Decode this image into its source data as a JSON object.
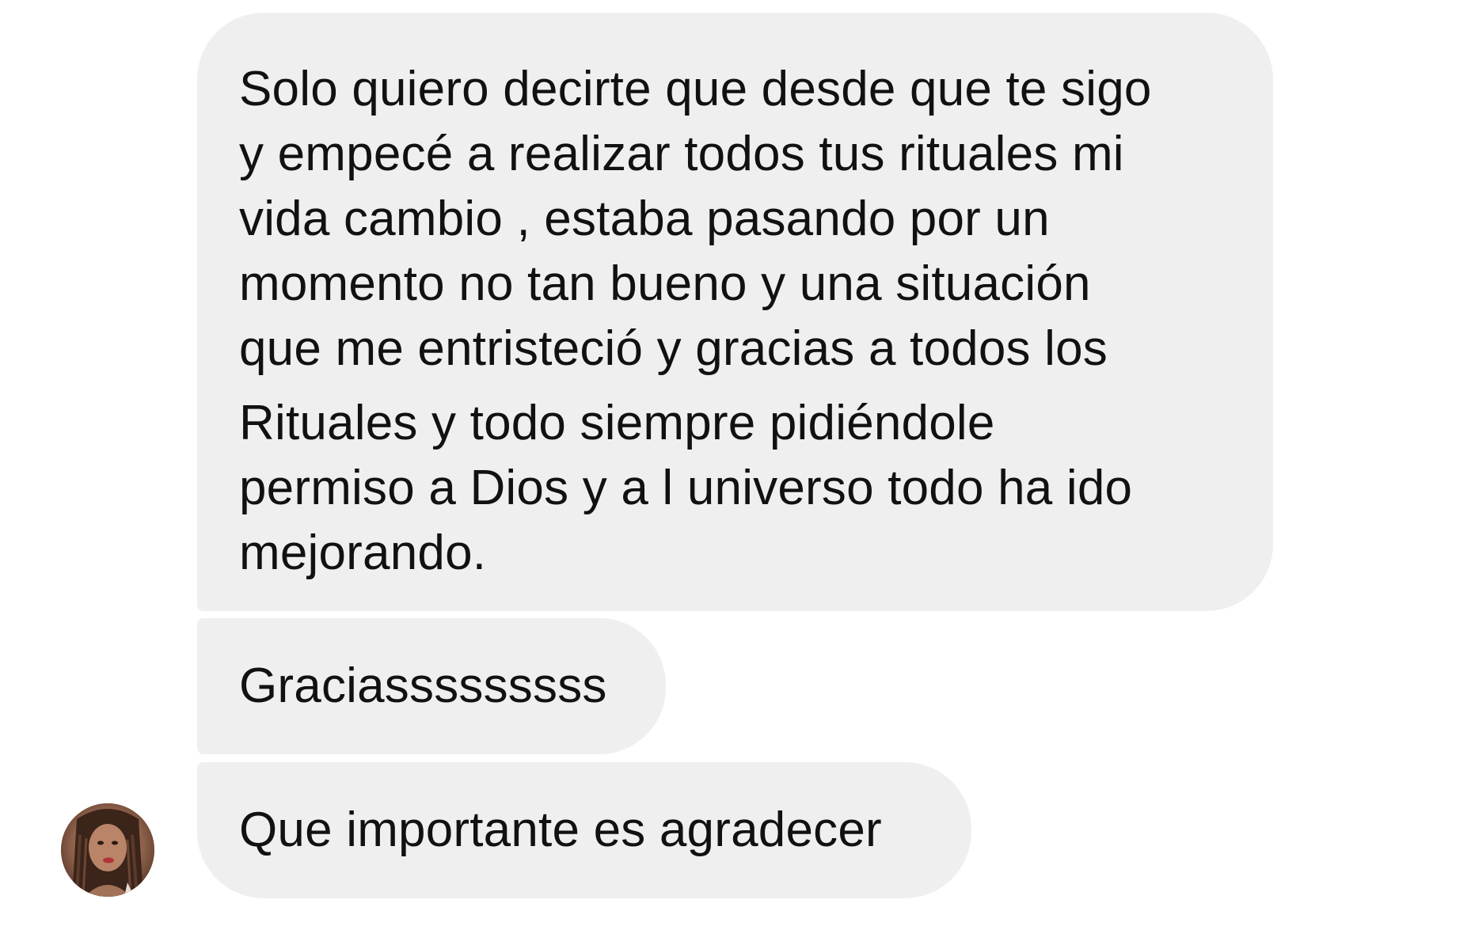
{
  "messages": [
    {
      "lines": [
        "Solo quiero decirte que desde que te sigo",
        "y empecé a realizar todos tus rituales mi",
        "vida cambio , estaba pasando por un",
        "momento no tan bueno y una situación",
        "que me entristeció y gracias a todos los",
        "Rituales y todo siempre pidiéndole",
        "permiso a Dios y a l universo todo ha ido",
        "mejorando."
      ]
    },
    {
      "text": "Graciasssssssss"
    },
    {
      "text": "Que importante es agradecer"
    }
  ],
  "avatar": {
    "icon": "profile-photo"
  },
  "colors": {
    "background": "#ffffff",
    "bubble": "#efefef",
    "text": "#111111"
  }
}
